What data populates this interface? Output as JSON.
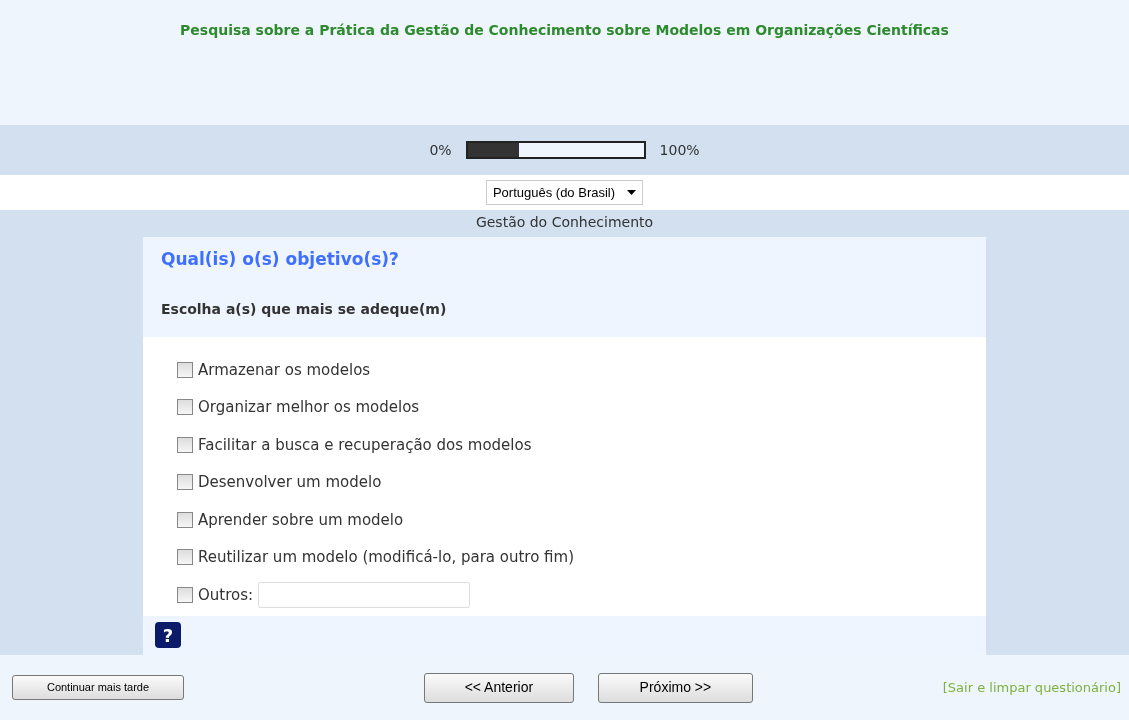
{
  "title": "Pesquisa sobre a Prática da Gestão de Conhecimento sobre Modelos em Organizações Científicas",
  "progress": {
    "start_label": "0%",
    "end_label": "100%",
    "level": 0.29
  },
  "language": {
    "value": "Português (do Brasil)"
  },
  "group_title": "Gestão do Conhecimento",
  "question": {
    "text": "Qual(is) o(s) objetivo(s)?",
    "help": "Escolha a(s) que mais se adeque(m)",
    "options": [
      {
        "kind": "checkbox",
        "label": "Armazenar os modelos",
        "checked": false
      },
      {
        "kind": "checkbox",
        "label": "Organizar melhor os modelos",
        "checked": false
      },
      {
        "kind": "checkbox",
        "label": "Facilitar a busca e recuperação dos modelos",
        "checked": false
      },
      {
        "kind": "checkbox",
        "label": "Desenvolver um modelo",
        "checked": false
      },
      {
        "kind": "checkbox",
        "label": "Aprender sobre um modelo",
        "checked": false
      },
      {
        "kind": "checkbox",
        "label": "Reutilizar um modelo (modificá-lo, para outro fim)",
        "checked": false
      },
      {
        "kind": "other",
        "label": "Outros:",
        "checked": false
      }
    ],
    "help_icon": "?"
  },
  "footer": {
    "later": "Continuar mais tarde",
    "previous": "<< Anterior",
    "next": "Próximo >>",
    "exit": "[Sair e limpar questionário]"
  }
}
